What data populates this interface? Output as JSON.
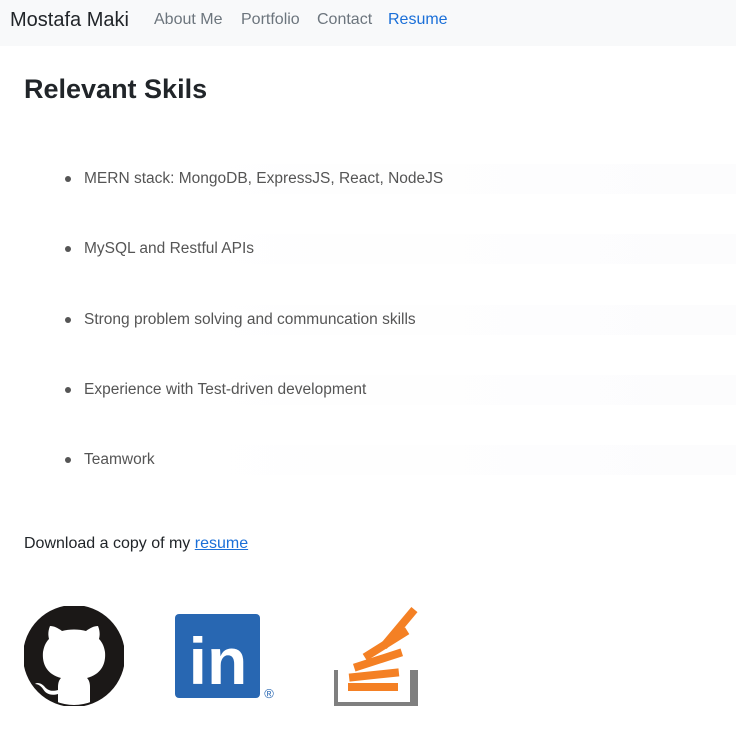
{
  "navbar": {
    "brand": "Mostafa Maki",
    "links": [
      "About Me",
      "Portfolio",
      "Contact",
      "Resume"
    ],
    "active": "Resume"
  },
  "section": {
    "title": "Relevant Skils",
    "skills": [
      "MERN stack: MongoDB, ExpressJS, React, NodeJS",
      "MySQL and Restful APIs",
      "Strong problem solving and communcation skills",
      "Experience with Test-driven development",
      "Teamwork"
    ]
  },
  "download": {
    "prefix": "Download a copy of my",
    "link_label": "resume"
  },
  "social": {
    "icons": [
      "github-icon",
      "linkedin-icon",
      "stackoverflow-icon"
    ],
    "linkedin_text": "in",
    "linkedin_mark": "®"
  },
  "colors": {
    "navbar_bg": "#f8f9fa",
    "active_link": "#1a6fd8",
    "linkedin_blue": "#2867b2",
    "stackoverflow_orange": "#f48024",
    "stackoverflow_gray": "#7f7f7f"
  }
}
